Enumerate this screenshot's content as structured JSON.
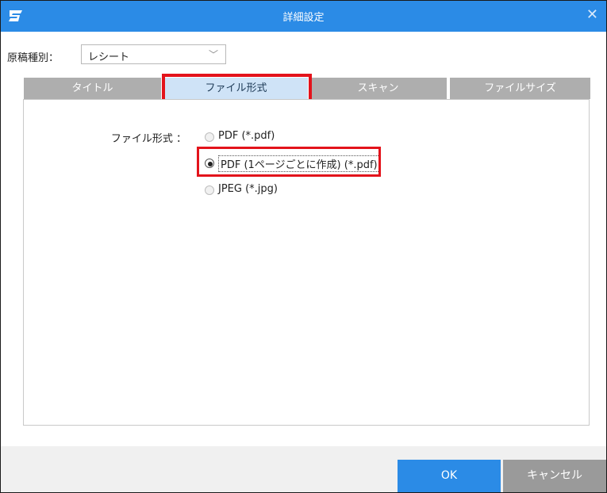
{
  "window": {
    "title": "詳細設定",
    "close_glyph": "✕"
  },
  "document_type": {
    "label": "原稿種別：",
    "value": "レシート"
  },
  "tabs": [
    {
      "label": "タイトル"
    },
    {
      "label": "ファイル形式",
      "selected": true
    },
    {
      "label": "スキャン"
    },
    {
      "label": "ファイルサイズ"
    }
  ],
  "file_format": {
    "label": "ファイル形式 ：",
    "options": [
      {
        "label": "PDF (*.pdf)",
        "checked": false
      },
      {
        "label": "PDF (1ページごとに作成) (*.pdf)",
        "checked": true
      },
      {
        "label": "JPEG (*.jpg)",
        "checked": false
      }
    ]
  },
  "buttons": {
    "ok": "OK",
    "cancel": "キャンセル"
  },
  "colors": {
    "titlebar": "#2b8be6",
    "highlight": "#e3131b",
    "tab_selected": "#cfe3f7",
    "tab_inactive": "#aeaeae",
    "ok_button": "#2b8be6",
    "cancel_button": "#9a9a9a"
  },
  "icons": {
    "app": "scansnap-logo-icon",
    "dropdown": "chevron-down-icon",
    "close": "close-icon"
  }
}
